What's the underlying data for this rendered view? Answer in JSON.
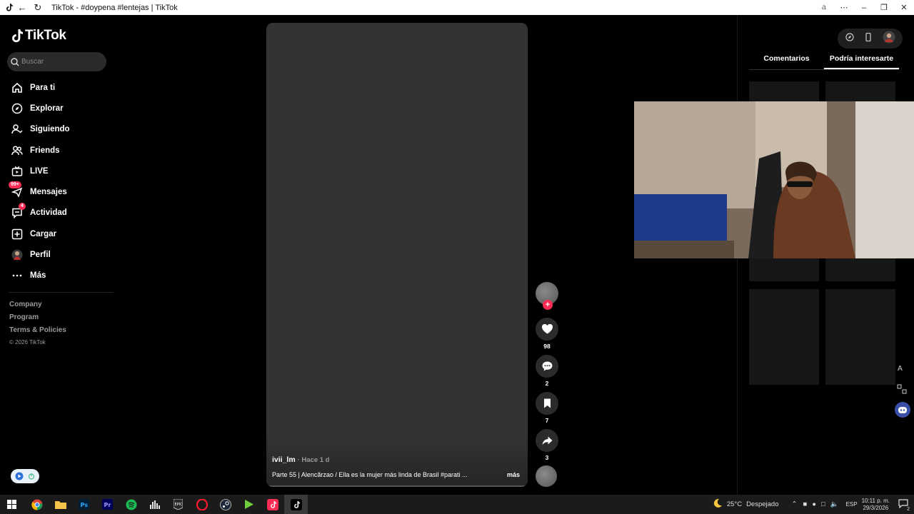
{
  "window": {
    "title": "TikTok - #doypena #lentejas | TikTok"
  },
  "sidebar": {
    "logo": "TikTok",
    "search_placeholder": "Buscar",
    "items": [
      {
        "label": "Para ti",
        "icon": "home-icon"
      },
      {
        "label": "Explorar",
        "icon": "compass-icon"
      },
      {
        "label": "Siguiendo",
        "icon": "following-icon"
      },
      {
        "label": "Friends",
        "icon": "friends-icon"
      },
      {
        "label": "LIVE",
        "icon": "live-icon"
      },
      {
        "label": "Mensajes",
        "icon": "messages-icon",
        "badge": "99+"
      },
      {
        "label": "Actividad",
        "icon": "activity-icon",
        "badge": "4"
      },
      {
        "label": "Cargar",
        "icon": "upload-icon"
      },
      {
        "label": "Perfil",
        "icon": "avatar"
      },
      {
        "label": "Más",
        "icon": "more-icon"
      }
    ],
    "footer": [
      "Company",
      "Program",
      "Terms & Policies"
    ],
    "copyright": "© 2026 TikTok"
  },
  "video": {
    "author": "ivii_lm",
    "time_ago": "· Hace 1 d",
    "description": "Parte 55 | Alencãrzao / Ella es la mujer más linda de Brasil #parati ...",
    "more_label": "más"
  },
  "actions": {
    "likes": "98",
    "comments": "2",
    "saves": "7",
    "shares": "3"
  },
  "panel": {
    "tabs": [
      "Comentarios",
      "Podría interesarte"
    ],
    "active_tab": "Podría interesarte"
  },
  "taskbar": {
    "weather_temp": "25°C",
    "weather_text": "Despejado",
    "language": "ESP",
    "time": "10:11 p. m.",
    "date": "29/3/2026",
    "notification_count": "2"
  },
  "colors": {
    "accent": "#fe2c55",
    "background": "#000000",
    "video_bg": "#333333"
  }
}
